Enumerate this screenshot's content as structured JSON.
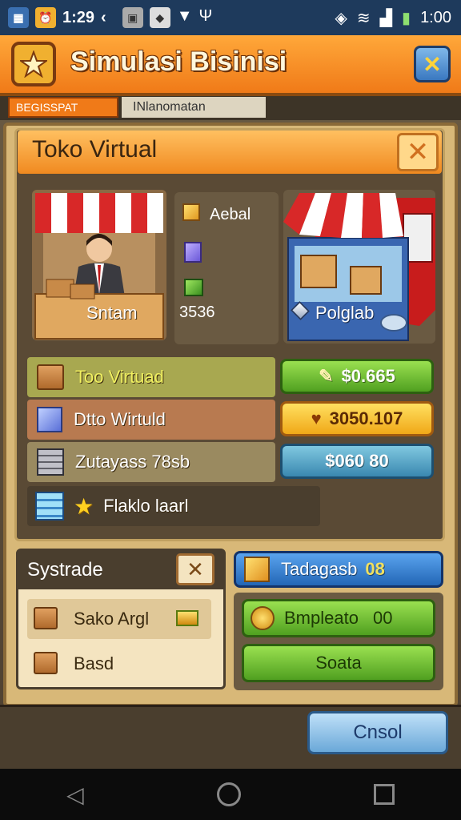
{
  "status": {
    "time_left": "1:29",
    "time_right": "1:00"
  },
  "title": {
    "text": "Simulasi Bisinisi"
  },
  "tabs": {
    "tab1": "BEGISSPAT",
    "tab2": "INlanomatan"
  },
  "panel": {
    "header": "Toko Virtual"
  },
  "stall": {
    "label": "Sntam"
  },
  "info": {
    "line1": "Aebal",
    "line3": "3536"
  },
  "shop": {
    "label": "Polglab"
  },
  "rows": [
    {
      "label": "Too Virtuad",
      "price": "$0.665"
    },
    {
      "label": "Dtto Wirtuld",
      "price": "3050.107"
    },
    {
      "label": "Zutayass 78sb",
      "price": "$060 80"
    },
    {
      "label": "Flaklo laarl"
    }
  ],
  "bottom": {
    "title": "Systrade",
    "item1": "Sako Argl",
    "item2": "Basd",
    "trade_btn": "Tadagasb",
    "trade_count": "08",
    "complete_btn": "Bmpleato",
    "complete_val": "00",
    "confirm_btn": "Soata",
    "cancel_btn": "Cnsol"
  },
  "colors": {
    "accent": "#f07a18",
    "green": "#50a020",
    "yellow": "#f0a818",
    "blue": "#2366b6"
  }
}
